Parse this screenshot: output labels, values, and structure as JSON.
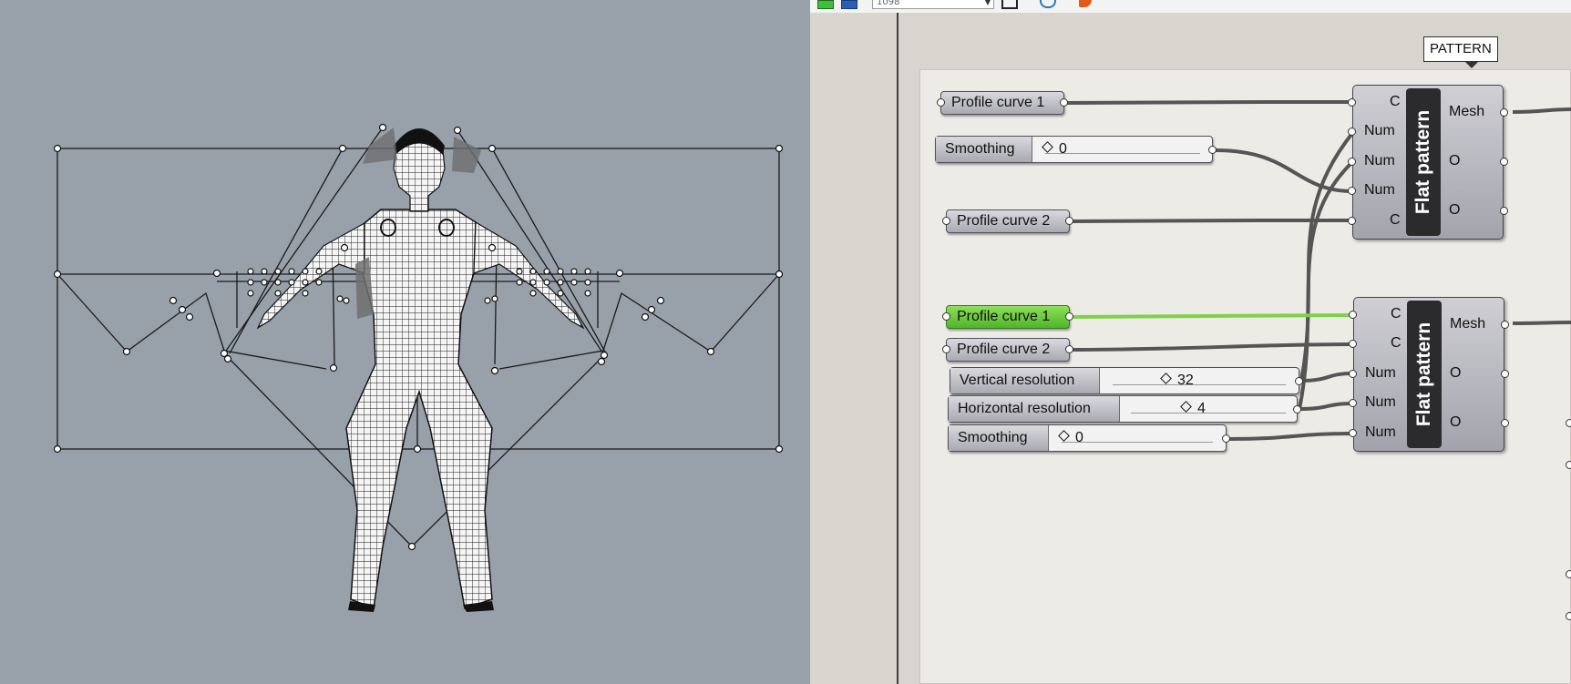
{
  "toolbar": {
    "zoom_value": "1098",
    "icons": [
      "green-square-icon",
      "save-icon",
      "combo-dropdown-icon",
      "zoom-extents-icon",
      "preview-icon",
      "bake-icon"
    ]
  },
  "viewport": {
    "background_color": "#98a1aa",
    "model_description": "wireframe human figure mesh with control polygon"
  },
  "canvas": {
    "pattern_tag": "PATTERN",
    "params": [
      {
        "id": "pc1a",
        "label": "Profile curve 1",
        "selected": false
      },
      {
        "id": "pc2a",
        "label": "Profile curve 2",
        "selected": false
      },
      {
        "id": "pc1b",
        "label": "Profile curve 1",
        "selected": true
      },
      {
        "id": "pc2b",
        "label": "Profile curve 2",
        "selected": false
      }
    ],
    "sliders": [
      {
        "id": "smoothA",
        "label": "Smoothing",
        "value": "0"
      },
      {
        "id": "vres",
        "label": "Vertical resolution",
        "value": "32"
      },
      {
        "id": "hres",
        "label": "Horizontal resolution",
        "value": "4"
      },
      {
        "id": "smoothB",
        "label": "Smoothing",
        "value": "0"
      }
    ],
    "components": [
      {
        "id": "fp1",
        "title": "Flat pattern",
        "inputs": [
          "C",
          "Num",
          "Num",
          "Num",
          "C"
        ],
        "outputs": [
          "Mesh",
          "O",
          "O"
        ]
      },
      {
        "id": "fp2",
        "title": "Flat pattern",
        "inputs": [
          "C",
          "C",
          "Num",
          "Num",
          "Num"
        ],
        "outputs": [
          "Mesh",
          "O",
          "O"
        ]
      }
    ],
    "colors": {
      "selected_wire": "#7fd14a",
      "wire": "#555555",
      "canvas": "#edebe6"
    }
  }
}
